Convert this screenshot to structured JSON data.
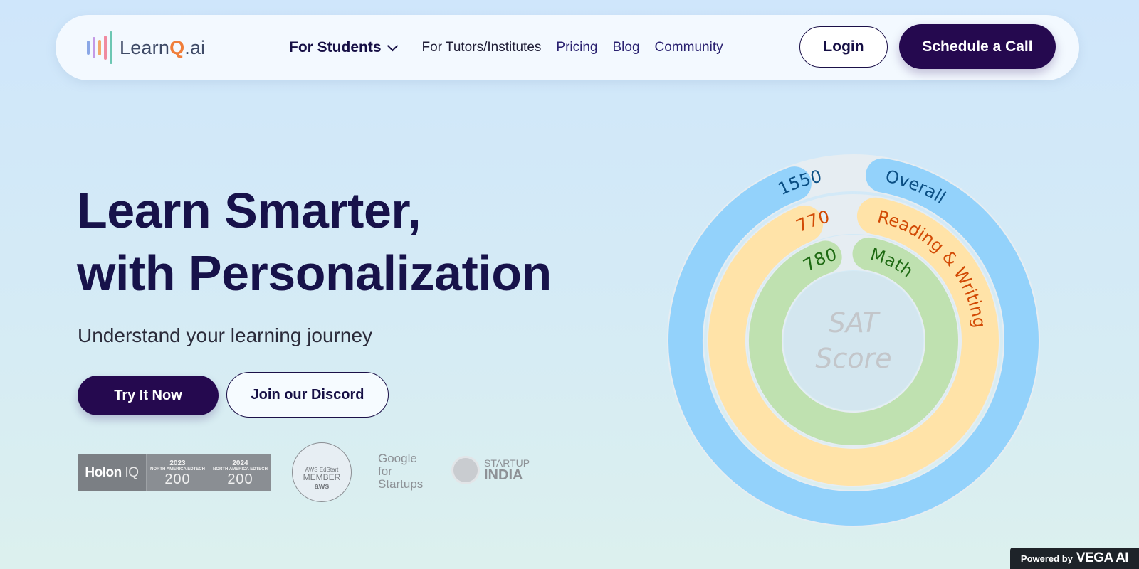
{
  "nav": {
    "logo_text_a": "Learn",
    "logo_text_q": "Q",
    "logo_text_b": ".ai",
    "for_students": "For Students",
    "for_tutors": "For Tutors/Institutes",
    "pricing": "Pricing",
    "blog": "Blog",
    "community": "Community",
    "login": "Login",
    "schedule_call": "Schedule a Call"
  },
  "hero": {
    "title_line1": "Learn Smarter,",
    "title_line2": "with Personalization",
    "subtitle": "Understand your learning journey",
    "try_button": "Try It Now",
    "discord_button": "Join our Discord"
  },
  "badges": {
    "holon_brand": "Holon",
    "holon_iq": "IQ",
    "holon_2023_year": "2023",
    "holon_2024_year": "2024",
    "holon_caption": "NORTH AMERICA EDTECH",
    "holon_number": "200",
    "aws_line1": "AWS EdStart",
    "aws_line2": "MEMBER",
    "aws_line3": "aws",
    "google_line1": "Google",
    "google_line2": "for",
    "google_line3": "Startups",
    "startup_line1": "STARTUP",
    "startup_line2": "INDIA"
  },
  "chart_data": {
    "type": "radial-progress",
    "center_text_line1": "SAT",
    "center_text_line2": "Score",
    "rings": [
      {
        "label": "Overall",
        "value_label": "1550",
        "value": 1550,
        "max": 1600,
        "color": "#93d2fb",
        "label_color": "#0b4f84"
      },
      {
        "label": "Reading & Writing",
        "value_label": "770",
        "value": 770,
        "max": 800,
        "color": "#ffe3a8",
        "label_color": "#d24a05"
      },
      {
        "label": "Math",
        "value_label": "780",
        "value": 780,
        "max": 800,
        "color": "#bfe1b0",
        "label_color": "#1e6a12"
      }
    ]
  },
  "footer": {
    "powered_by": "Powered by",
    "vega_ai": "VEGA AI"
  }
}
